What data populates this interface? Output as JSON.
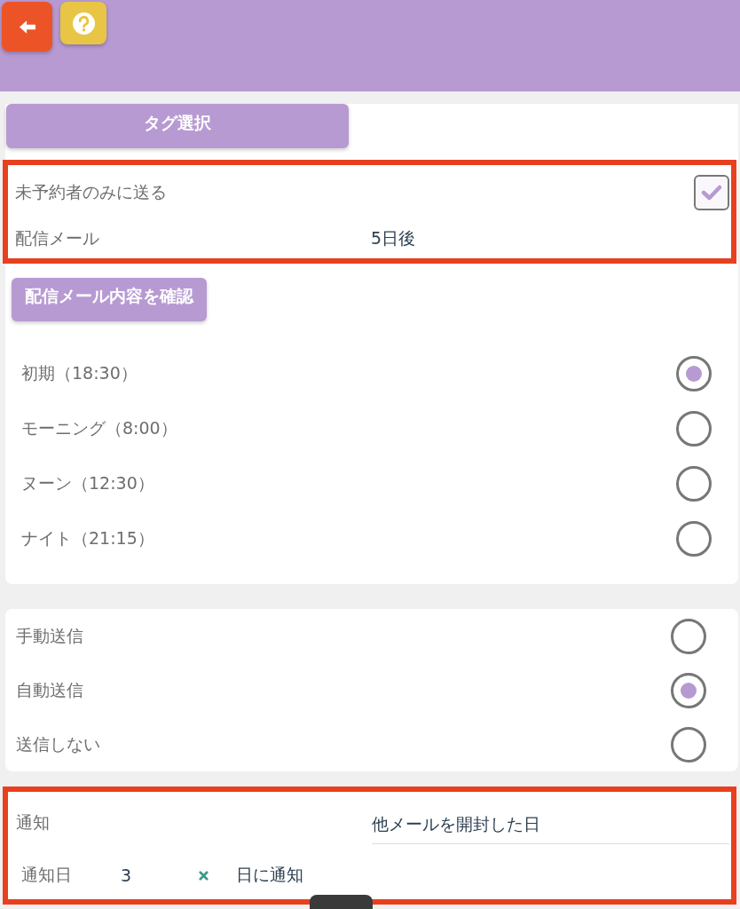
{
  "header": {
    "buttons": [
      {
        "kind": "back"
      },
      {
        "kind": "help"
      }
    ]
  },
  "tag_button": {
    "label": "タグ選択"
  },
  "delivery": {
    "highlighted": true,
    "rows": [
      {
        "kind": "checkbox",
        "label": "未予約者のみに送る",
        "checked": true
      },
      {
        "kind": "value",
        "label": "配信メール",
        "value": "5日後"
      }
    ]
  },
  "confirm_button": {
    "label": "配信メール内容を確認"
  },
  "time_options": [
    {
      "label": "初期（18:30）",
      "selected": true
    },
    {
      "label": "モーニング（8:00）",
      "selected": false
    },
    {
      "label": "ヌーン（12:30）",
      "selected": false
    },
    {
      "label": "ナイト（21:15）",
      "selected": false
    }
  ],
  "send_options": [
    {
      "label": "手動送信",
      "selected": false
    },
    {
      "label": "自動送信",
      "selected": true
    },
    {
      "label": "送信しない",
      "selected": false
    }
  ],
  "notification": {
    "highlighted": true,
    "rows": [
      {
        "kind": "select",
        "label": "通知",
        "value": "他メールを開封した日"
      },
      {
        "kind": "days",
        "label": "通知日",
        "value": "3",
        "suffix": "日に通知"
      }
    ]
  }
}
